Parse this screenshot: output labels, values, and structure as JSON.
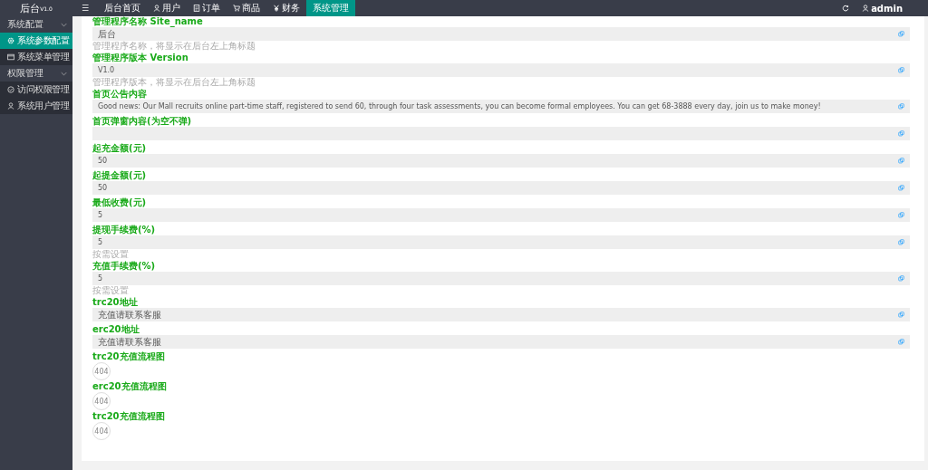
{
  "logo": "后台$^{V1.0}$",
  "top_nav": {
    "menu_icon": "☰",
    "items": [
      {
        "label": "后台首页",
        "selected": false
      },
      {
        "label": "用户",
        "selected": false
      },
      {
        "label": "订单",
        "selected": false
      },
      {
        "label": "商品",
        "selected": false
      },
      {
        "label": "财务",
        "selected": false
      },
      {
        "label": "系统管理",
        "selected": true
      }
    ],
    "user": "admin"
  },
  "sidebar": {
    "groups": [
      {
        "label": "系统配置",
        "expanded": true,
        "children": [
          {
            "label": "系统参数配置",
            "selected": true
          },
          {
            "label": "系统菜单管理",
            "selected": false
          }
        ]
      },
      {
        "label": "权限管理",
        "expanded": true,
        "children": [
          {
            "label": "访问权限管理",
            "selected": false
          },
          {
            "label": "系统用户管理",
            "selected": false
          }
        ]
      }
    ]
  },
  "form": [
    {
      "kind": "field",
      "label": "管理程序名称 Site_name",
      "value": "后台",
      "hint": "管理程序名称，将显示在后台左上角标题"
    },
    {
      "kind": "field",
      "label": "管理程序版本 Version",
      "value": "V1.0",
      "hint": "管理程序版本，将显示在后台左上角标题"
    },
    {
      "kind": "field",
      "label": "首页公告内容",
      "value": "Good news: Our Mall recruits online part-time staff, registered to send 60, through four task assessments, you can become formal employees. You can get 68-3888 every day, join us to make money!"
    },
    {
      "kind": "field",
      "label": "首页弹窗内容(为空不弹)"
    },
    {
      "kind": "field",
      "label": "起充金额(元)",
      "value": "50"
    },
    {
      "kind": "field",
      "label": "起提金额(元)",
      "value": "50"
    },
    {
      "kind": "field",
      "label": "最低收费(元)",
      "value": "5"
    },
    {
      "kind": "field",
      "label": "提现手续费(%)",
      "value": "5",
      "hint": "按需设置"
    },
    {
      "kind": "field",
      "label": "充值手续费(%)",
      "value": "5",
      "hint": "按需设置"
    },
    {
      "kind": "field",
      "label": "trc20地址",
      "value": "充值请联系客服"
    },
    {
      "kind": "field",
      "label": "erc20地址",
      "value": "充值请联系客服"
    },
    {
      "kind": "image",
      "label": "trc20充值流程图",
      "image_text": "404"
    },
    {
      "kind": "image",
      "label": "erc20充值流程图",
      "image_text": "404"
    },
    {
      "kind": "image",
      "label": "trc20充值流程图",
      "image_text": "404"
    }
  ]
}
